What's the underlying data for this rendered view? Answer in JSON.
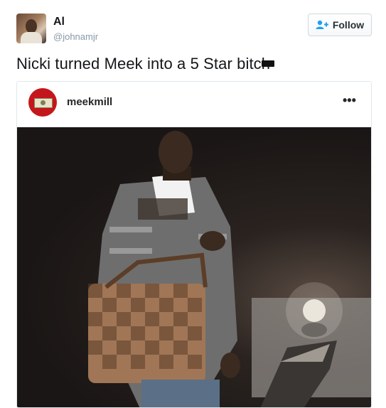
{
  "header": {
    "display_name": "Al",
    "handle": "@johnamjr",
    "follow_label": "Follow",
    "avatar_icon": "user-avatar",
    "follow_icon": "add-user-icon"
  },
  "tweet": {
    "text": "Nicki turned Meek into a 5 Star bitch"
  },
  "embed": {
    "username": "meekmill",
    "more_label": "•••",
    "avatar_icon": "money-bill-avatar",
    "photo_subject": "photo"
  },
  "colors": {
    "follow_icon": "#1da1f2",
    "ig_avatar": "#c4171c",
    "text": "#14171a",
    "muted": "#8899a6"
  }
}
